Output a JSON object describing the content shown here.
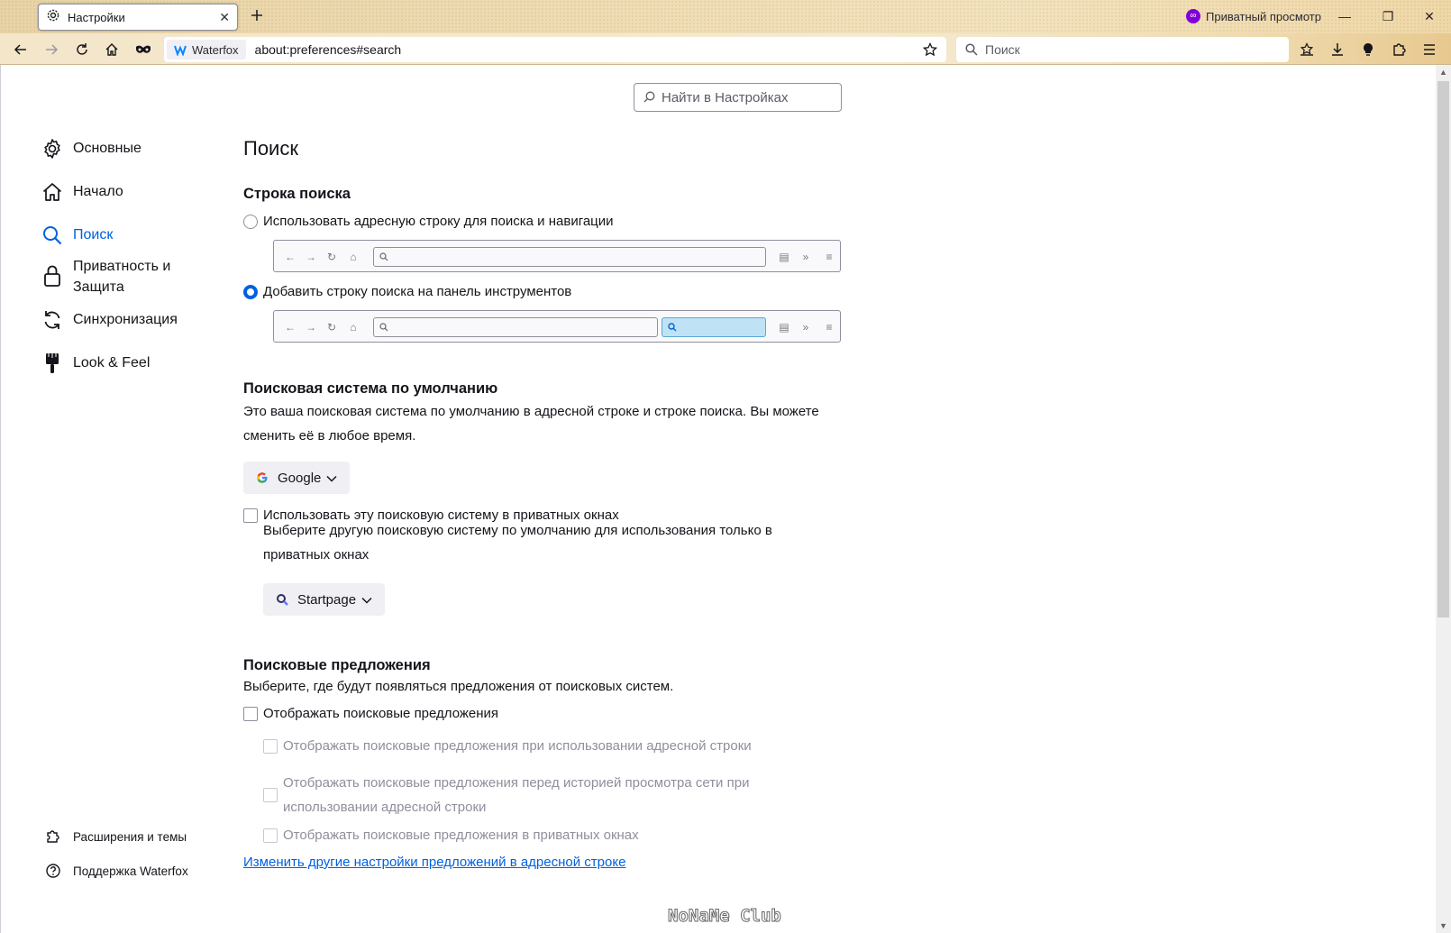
{
  "tab": {
    "title": "Настройки",
    "close": "✕"
  },
  "private": {
    "label": "Приватный просмотр",
    "badge": "∞"
  },
  "window": {
    "minimize": "—",
    "restore": "❐",
    "close": "✕"
  },
  "urlbar": {
    "identity": "Waterfox",
    "url": "about:preferences#search"
  },
  "searchbar": {
    "placeholder": "Поиск"
  },
  "prefs_search": {
    "placeholder": "Найти в Настройках"
  },
  "sidebar": {
    "items": [
      {
        "label": "Основные",
        "icon": "gear-icon"
      },
      {
        "label": "Начало",
        "icon": "home-icon"
      },
      {
        "label": "Поиск",
        "icon": "search-icon"
      },
      {
        "label": "Приватность и Защита",
        "icon": "lock-icon"
      },
      {
        "label": "Синхронизация",
        "icon": "sync-icon"
      },
      {
        "label": "Look & Feel",
        "icon": "brush-icon"
      }
    ],
    "footer": [
      {
        "label": "Расширения и темы",
        "icon": "puzzle-icon"
      },
      {
        "label": "Поддержка Waterfox",
        "icon": "help-icon"
      }
    ]
  },
  "page": {
    "title": "Поиск",
    "searchbar_section": {
      "heading": "Строка поиска",
      "option1": "Использовать адресную строку для поиска и навигации",
      "option2": "Добавить строку поиска на панель инструментов",
      "selected": "option2"
    },
    "default_engine": {
      "heading": "Поисковая система по умолчанию",
      "desc": "Это ваша поисковая система по умолчанию в адресной строке и строке поиска. Вы можете сменить её в любое время.",
      "engine": "Google",
      "private_checkbox": "Использовать эту поисковую систему в приватных окнах",
      "private_desc": "Выберите другую поисковую систему по умолчанию для использования только в приватных окнах",
      "private_engine": "Startpage"
    },
    "suggestions": {
      "heading": "Поисковые предложения",
      "desc": "Выберите, где будут появляться предложения от поисковых систем.",
      "show": "Отображать поисковые предложения",
      "in_urlbar": "Отображать поисковые предложения при использовании адресной строки",
      "before_history": "Отображать поисковые предложения перед историей просмотра сети при использовании адресной строки",
      "in_private": "Отображать поисковые предложения в приватных окнах",
      "link": "Изменить другие настройки предложений в адресной строке"
    }
  },
  "watermark": "NoNaMe Club",
  "colors": {
    "accent": "#0061e0",
    "highlight": "#bfe2f5",
    "private": "#8000d7"
  }
}
